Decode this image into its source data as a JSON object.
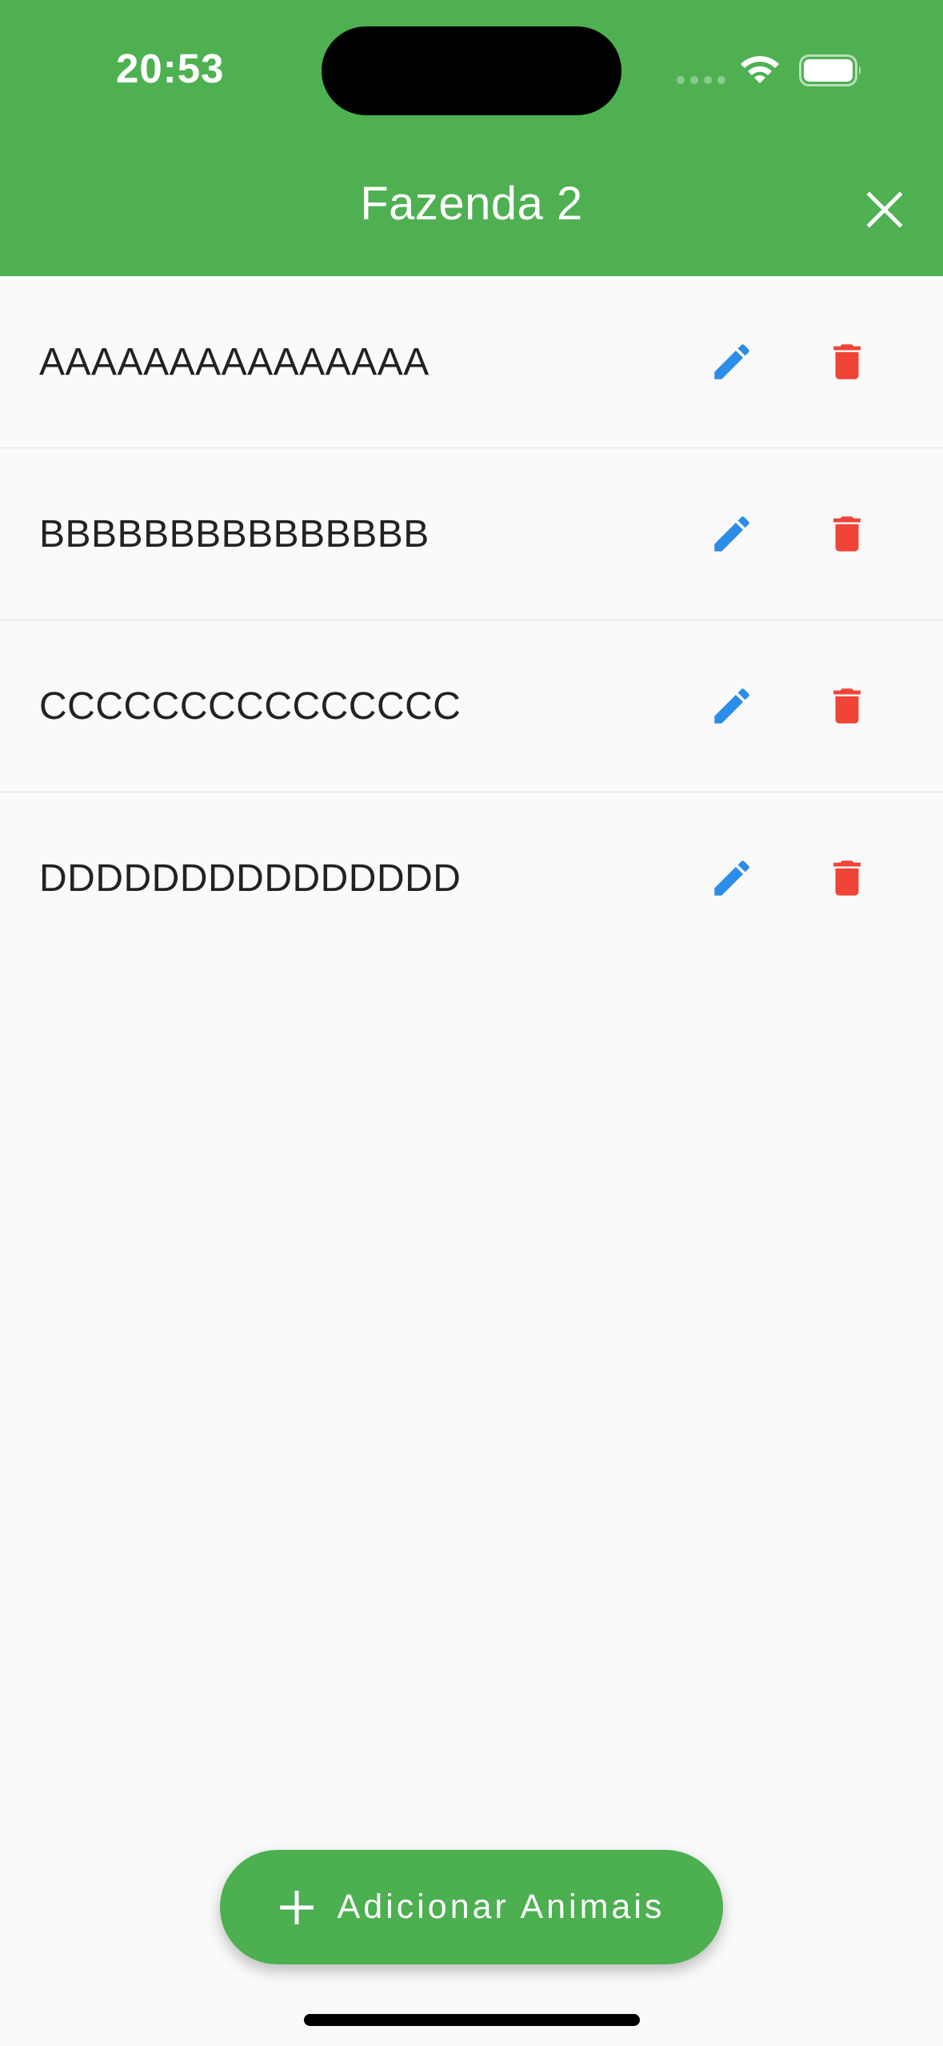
{
  "status_bar": {
    "time": "20:53",
    "icons": [
      "signal-icon",
      "wifi-icon",
      "battery-icon"
    ]
  },
  "header": {
    "title": "Fazenda 2",
    "close_icon": "close-icon"
  },
  "list": {
    "items": [
      {
        "label": "AAAAAAAAAAAAAAA"
      },
      {
        "label": "BBBBBBBBBBBBBBB"
      },
      {
        "label": "CCCCCCCCCCCCCCC"
      },
      {
        "label": "DDDDDDDDDDDDDDD"
      }
    ],
    "edit_icon": "pencil-icon",
    "delete_icon": "trash-icon"
  },
  "fab": {
    "label": "Adicionar Animais",
    "icon": "plus-icon"
  },
  "colors": {
    "header": "#4fb052",
    "fab": "#4caf50",
    "edit": "#2b8de8",
    "delete": "#f04438",
    "background": "#fafafa"
  }
}
